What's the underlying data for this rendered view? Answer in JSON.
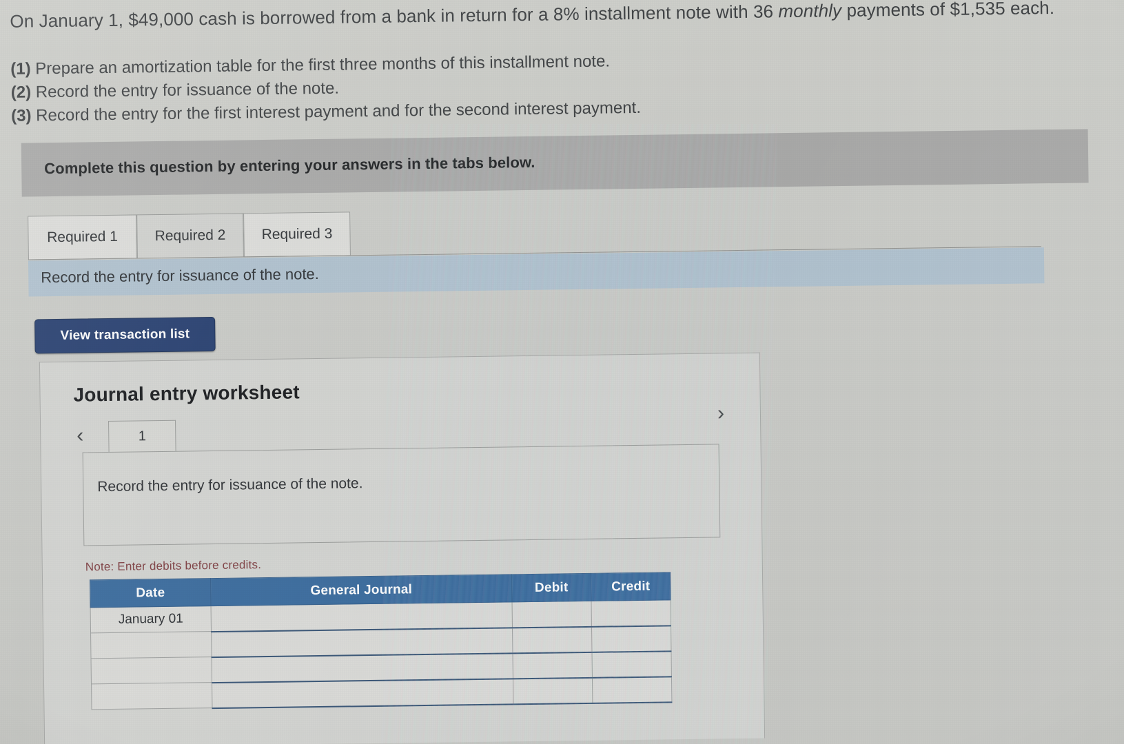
{
  "problem": {
    "statement_part1": "On January 1, $49,000 cash is borrowed from a bank in return for a 8% installment note with 36 ",
    "statement_italic": "monthly",
    "statement_part2": " payments of $1,535 each.",
    "requirements": [
      {
        "num": "(1)",
        "text": " Prepare an amortization table for the first three months of this installment note."
      },
      {
        "num": "(2)",
        "text": " Record the entry for issuance of the note."
      },
      {
        "num": "(3)",
        "text": " Record the entry for the first interest payment and for the second interest payment."
      }
    ]
  },
  "banner": {
    "text": "Complete this question by entering your answers in the tabs below."
  },
  "tabs": [
    {
      "label": "Required 1",
      "active": false
    },
    {
      "label": "Required 2",
      "active": true
    },
    {
      "label": "Required 3",
      "active": false
    }
  ],
  "subheader": {
    "text": "Record the entry for issuance of the note."
  },
  "toolbar": {
    "view_transaction_list_label": "View transaction list"
  },
  "worksheet": {
    "title": "Journal entry worksheet",
    "prev_icon": "chevron-left-icon",
    "next_icon": "chevron-right-icon",
    "prev_glyph": "‹",
    "next_glyph": "›",
    "entry_tabs": [
      {
        "label": "1",
        "active": true
      }
    ],
    "description": "Record the entry for issuance of the note.",
    "note": "Note: Enter debits before credits."
  },
  "journal_table": {
    "columns": [
      "Date",
      "General Journal",
      "Debit",
      "Credit"
    ],
    "rows": [
      {
        "date": "January 01",
        "general_journal": "",
        "debit": "",
        "credit": ""
      },
      {
        "date": "",
        "general_journal": "",
        "debit": "",
        "credit": ""
      },
      {
        "date": "",
        "general_journal": "",
        "debit": "",
        "credit": ""
      },
      {
        "date": "",
        "general_journal": "",
        "debit": "",
        "credit": ""
      }
    ]
  },
  "colors": {
    "button_navy": "#1f3d7a",
    "table_header_blue": "#2f6cab",
    "subheader_blue": "#adc3d3",
    "banner_gray": "#a9aaa8",
    "note_red": "#8a3b3f",
    "page_bg": "#c9cac6"
  }
}
